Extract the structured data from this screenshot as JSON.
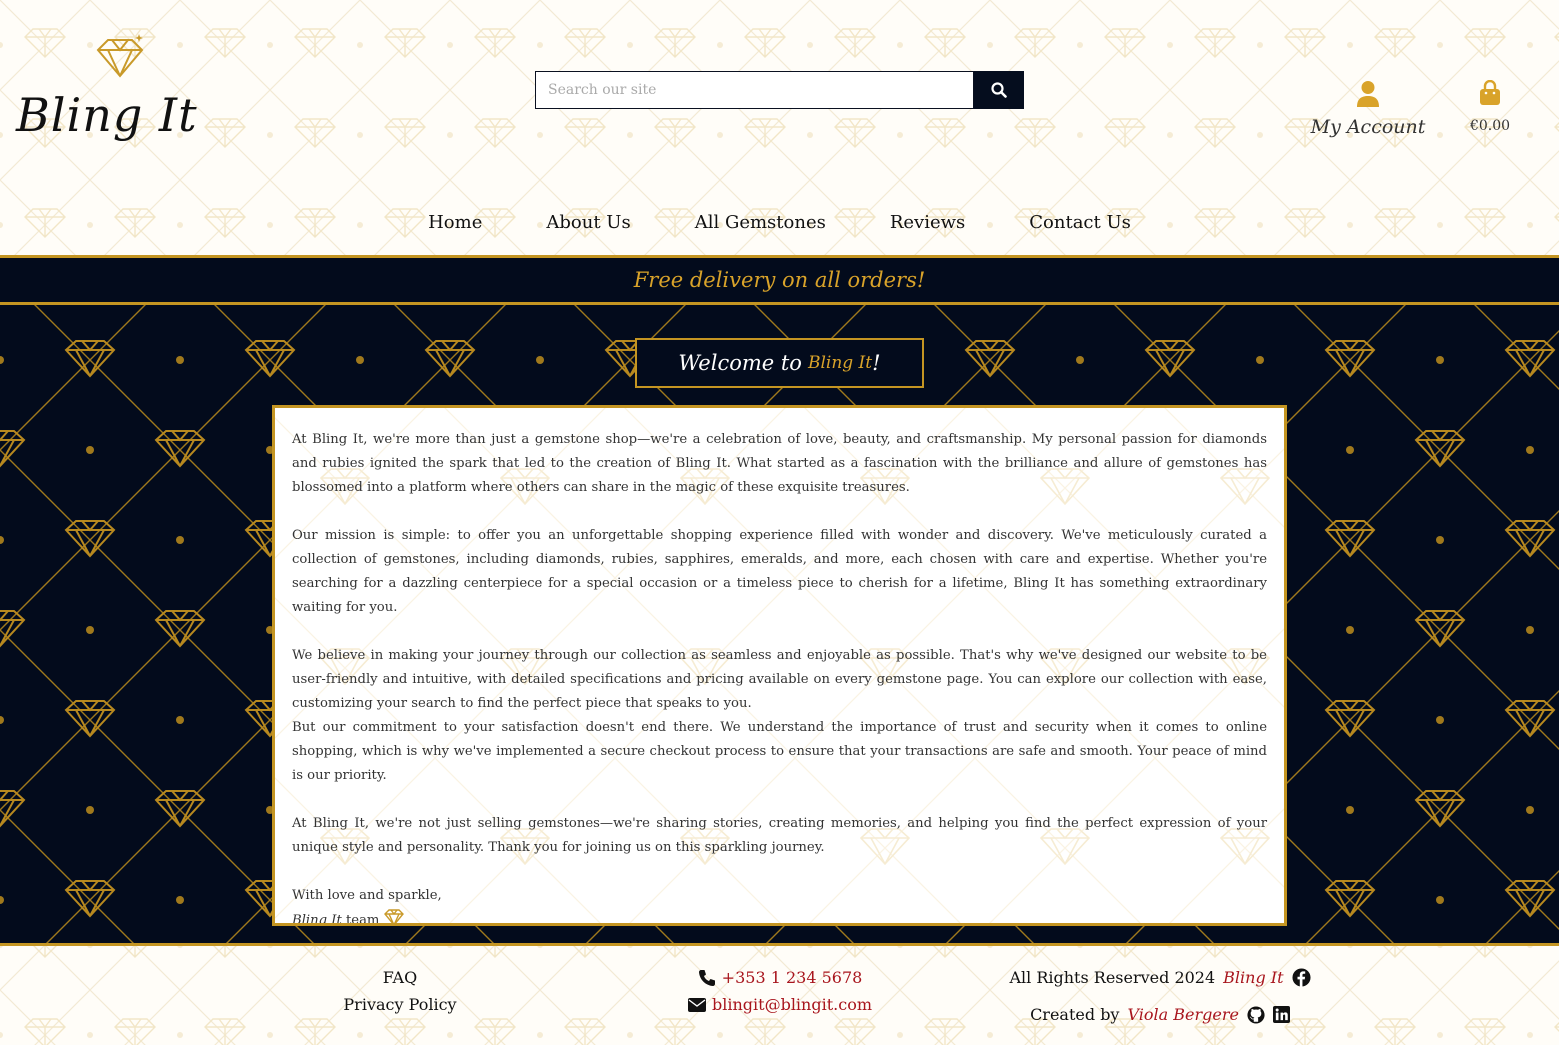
{
  "header": {
    "logo_text": "Bling It",
    "search_placeholder": "Search our site",
    "account_label": "My Account",
    "cart_total": "€0.00"
  },
  "nav": [
    "Home",
    "About Us",
    "All Gemstones",
    "Reviews",
    "Contact Us"
  ],
  "banner": {
    "text": "Free delivery on all orders!"
  },
  "welcome": {
    "prefix": "Welcome to",
    "brand": "Bling It",
    "suffix": "!"
  },
  "about": {
    "p1": "At Bling It, we're more than just a gemstone shop—we're a celebration of love, beauty, and craftsmanship. My personal passion for diamonds and rubies ignited the spark that led to the creation of Bling It. What started as a fascination with the brilliance and allure of gemstones has blossomed into a platform where others can share in the magic of these exquisite treasures.",
    "p2": "Our mission is simple: to offer you an unforgettable shopping experience filled with wonder and discovery. We've meticulously curated a collection of gemstones, including diamonds, rubies, sapphires, emeralds, and more, each chosen with care and expertise. Whether you're searching for a dazzling centerpiece for a special occasion or a timeless piece to cherish for a lifetime, Bling It has something extraordinary waiting for you.",
    "p3": "We believe in making your journey through our collection as seamless and enjoyable as possible. That's why we've designed our website to be user-friendly and intuitive, with detailed specifications and pricing available on every gemstone page. You can explore our collection with ease, customizing your search to find the perfect piece that speaks to you.",
    "p4": "But our commitment to your satisfaction doesn't end there. We understand the importance of trust and security when it comes to online shopping, which is why we've implemented a secure checkout process to ensure that your transactions are safe and smooth. Your peace of mind is our priority.",
    "p5": "At Bling It, we're not just selling gemstones—we're sharing stories, creating memories, and helping you find the perfect expression of your unique style and personality. Thank you for joining us on this sparkling journey.",
    "sign_line": "With love and sparkle,",
    "sign_brand": "Bling It",
    "sign_team": "team"
  },
  "footer": {
    "faq": "FAQ",
    "privacy": "Privacy Policy",
    "phone": "+353 1 234 5678",
    "email": "blingit@blingit.com",
    "rights": "All Rights Reserved 2024",
    "rights_brand": "Bling It",
    "created_by": "Created by",
    "author": "Viola Bergere"
  },
  "colors": {
    "navy": "#030b1c",
    "gold": "#c49522",
    "accent_red": "#a8151d"
  },
  "icons": [
    "diamond-icon",
    "search-icon",
    "user-icon",
    "shopping-bag-icon",
    "phone-icon",
    "envelope-icon",
    "facebook-icon",
    "github-icon",
    "linkedin-icon"
  ]
}
